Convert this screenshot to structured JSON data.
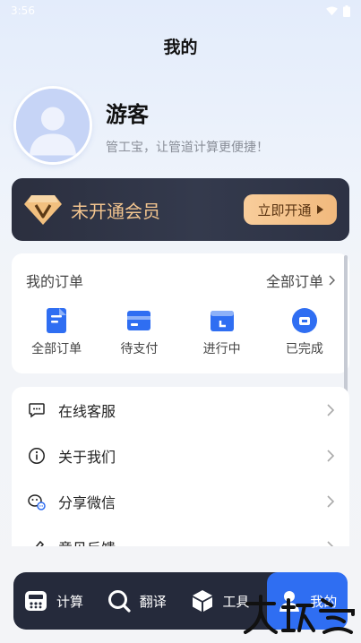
{
  "status_bar": {
    "time": "3:56"
  },
  "page": {
    "title": "我的"
  },
  "profile": {
    "name": "游客",
    "slogan": "管工宝，让管道计算更便捷！"
  },
  "vip": {
    "text": "未开通会员",
    "button_label": "立即开通",
    "colors": {
      "card": "#2b2f3f",
      "accent": "#f3c58f",
      "button": "#f1b97d"
    }
  },
  "orders": {
    "title": "我的订单",
    "all_label": "全部订单",
    "items": [
      {
        "label": "全部订单",
        "icon": "document-icon"
      },
      {
        "label": "待支付",
        "icon": "card-icon"
      },
      {
        "label": "进行中",
        "icon": "calendar-icon"
      },
      {
        "label": "已完成",
        "icon": "check-icon"
      }
    ],
    "icon_color": "#2f6ef2"
  },
  "menu": {
    "items": [
      {
        "label": "在线客服",
        "icon": "chat-icon"
      },
      {
        "label": "关于我们",
        "icon": "info-icon"
      },
      {
        "label": "分享微信",
        "icon": "wechat-share-icon"
      },
      {
        "label": "意见反馈",
        "icon": "feedback-icon"
      }
    ]
  },
  "bottom_nav": {
    "items": [
      {
        "label": "计算",
        "icon": "calculator-icon",
        "active": false
      },
      {
        "label": "翻译",
        "icon": "search-icon",
        "active": false
      },
      {
        "label": "工具",
        "icon": "box-icon",
        "active": false
      },
      {
        "label": "我的",
        "icon": "user-icon",
        "active": true
      }
    ],
    "colors": {
      "bar": "#252a3b",
      "active": "#2f6ef2"
    }
  }
}
